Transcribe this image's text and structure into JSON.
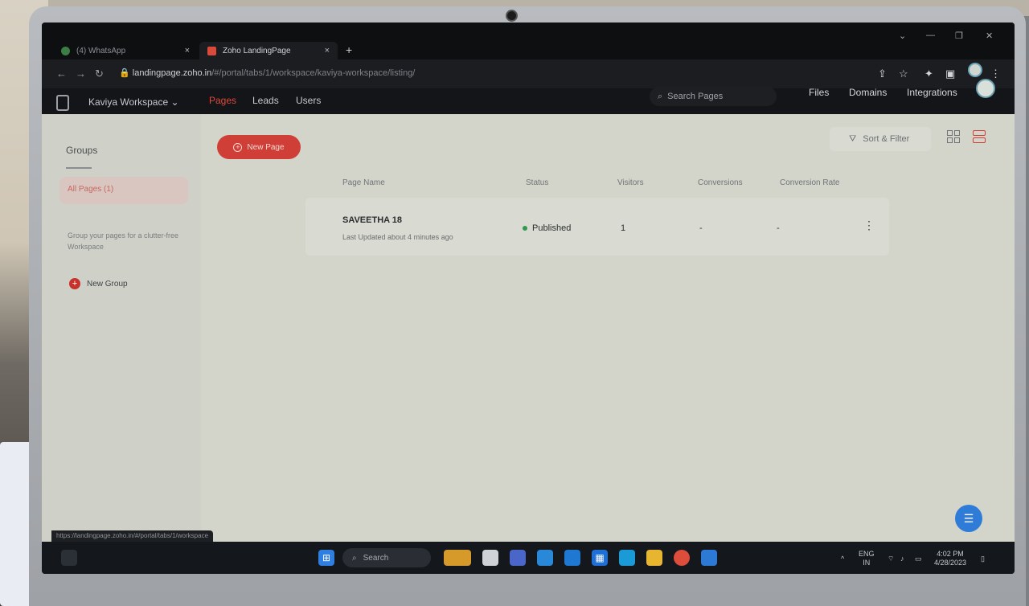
{
  "browser": {
    "tabs": [
      {
        "label": "(4) WhatsApp",
        "close": "×"
      },
      {
        "label": "Zoho LandingPage",
        "close": "×"
      }
    ],
    "new_tab": "+",
    "url_host": "landingpage.zoho.in",
    "url_path": "/#/portal/tabs/1/workspace/kaviya-workspace/listing/",
    "window_controls": [
      "⌄",
      "—",
      "❐",
      "✕"
    ],
    "status_bar_url": "https://landingpage.zoho.in/#/portal/tabs/1/workspace"
  },
  "app": {
    "workspace": "Kaviya Workspace",
    "nav": [
      "Pages",
      "Leads",
      "Users"
    ],
    "search_placeholder": "Search Pages",
    "header_links": [
      "Files",
      "Domains",
      "Integrations"
    ]
  },
  "sidebar": {
    "title": "Groups",
    "all_pages": "All Pages (1)",
    "hint": "Group your pages for a clutter-free Workspace",
    "new_group": "New Group"
  },
  "main": {
    "new_page": "New Page",
    "sort_filter": "Sort & Filter",
    "columns": [
      "Page Name",
      "Status",
      "Visitors",
      "Conversions",
      "Conversion Rate"
    ],
    "rows": [
      {
        "name": "SAVEETHA 18",
        "updated": "Last Updated about 4 minutes ago",
        "status": "Published",
        "visitors": "1",
        "conversions": "-",
        "conversion_rate": "-"
      }
    ]
  },
  "taskbar": {
    "search": "Search",
    "lang": "ENG",
    "region": "IN",
    "time": "4:02 PM",
    "date": "4/28/2023"
  },
  "colors": {
    "accent": "#cf3f37",
    "published": "#2f9a4f",
    "chat": "#2e7bd8"
  }
}
